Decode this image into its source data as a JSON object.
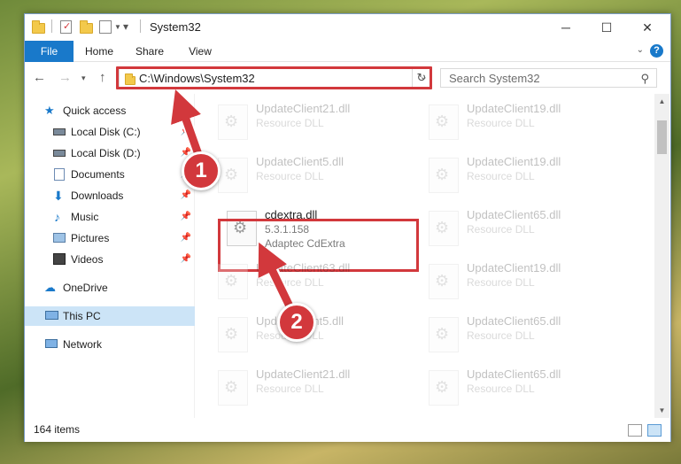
{
  "window": {
    "title": "System32",
    "controls": {
      "minimize": "─",
      "maximize": "☐",
      "close": "✕"
    }
  },
  "ribbon": {
    "tabs": [
      "File",
      "Home",
      "Share",
      "View"
    ],
    "help": "?"
  },
  "address": {
    "path": "C:\\Windows\\System32",
    "search_placeholder": "Search System32"
  },
  "nav": {
    "items": [
      {
        "label": "Quick access",
        "icon": "star-icon"
      },
      {
        "label": "Local Disk (C:)",
        "icon": "drive-icon",
        "pinned": true
      },
      {
        "label": "Local Disk (D:)",
        "icon": "drive-icon",
        "pinned": true
      },
      {
        "label": "Documents",
        "icon": "documents-icon",
        "pinned": true
      },
      {
        "label": "Downloads",
        "icon": "download-icon",
        "pinned": true
      },
      {
        "label": "Music",
        "icon": "music-icon",
        "pinned": true
      },
      {
        "label": "Pictures",
        "icon": "pictures-icon",
        "pinned": true
      },
      {
        "label": "Videos",
        "icon": "videos-icon",
        "pinned": true
      },
      {
        "label": "OneDrive",
        "icon": "cloud-icon"
      },
      {
        "label": "This PC",
        "icon": "computer-icon",
        "selected": true
      },
      {
        "label": "Network",
        "icon": "network-icon"
      }
    ]
  },
  "files": {
    "left": [
      {
        "name": "UpdateClient21.dll",
        "type": "Resource DLL"
      },
      {
        "name": "UpdateClient5.dll",
        "type": "Resource DLL"
      },
      {
        "name": "cdextra.dll",
        "version": "5.3.1.158",
        "company": "Adaptec CdExtra",
        "highlighted": true
      },
      {
        "name": "UpdateClient63.dll",
        "type": "Resource DLL"
      },
      {
        "name": "UpdateClient5.dll",
        "type": "Resource DLL"
      },
      {
        "name": "UpdateClient21.dll",
        "type": "Resource DLL"
      }
    ],
    "right": [
      {
        "name": "UpdateClient19.dll",
        "type": "Resource DLL"
      },
      {
        "name": "UpdateClient19.dll",
        "type": "Resource DLL"
      },
      {
        "name": "UpdateClient65.dll",
        "type": "Resource DLL"
      },
      {
        "name": "UpdateClient19.dll",
        "type": "Resource DLL"
      },
      {
        "name": "UpdateClient65.dll",
        "type": "Resource DLL"
      },
      {
        "name": "UpdateClient65.dll",
        "type": "Resource DLL"
      }
    ]
  },
  "status": {
    "item_count": "164 items"
  },
  "annotations": {
    "step1": "1",
    "step2": "2",
    "color": "#d2383c"
  }
}
